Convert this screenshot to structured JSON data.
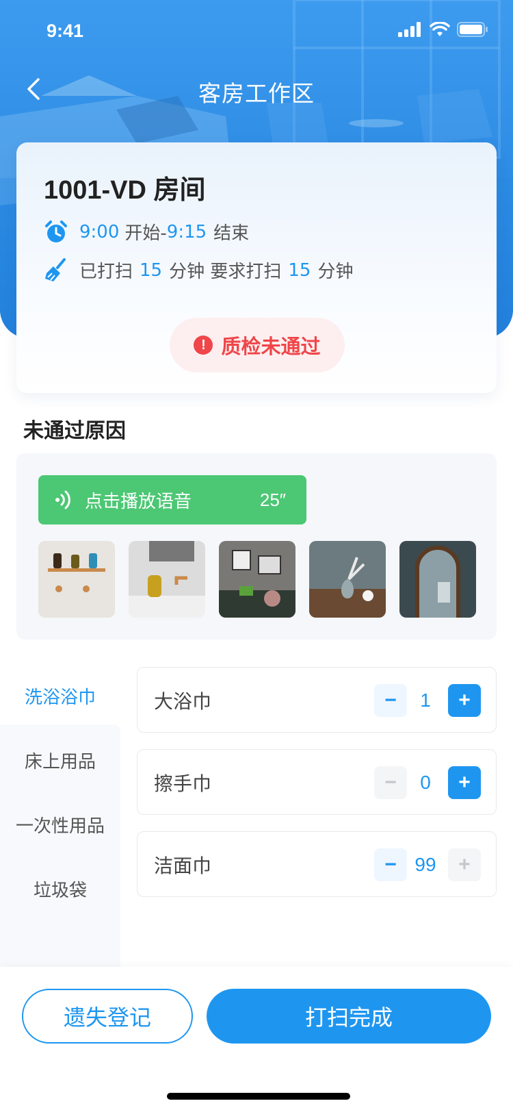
{
  "status_bar": {
    "time": "9:41"
  },
  "nav": {
    "title": "客房工作区"
  },
  "room_card": {
    "room": "1001-VD 房间",
    "time_start": "9:00",
    "time_start_suffix": "开始-",
    "time_end": "9:15",
    "time_end_suffix": "结束",
    "cleaned_prefix": "已打扫",
    "cleaned_minutes": "15",
    "cleaned_mid": "分钟 要求打扫",
    "required_minutes": "15",
    "cleaned_suffix": "分钟",
    "inspection_status": "质检未通过"
  },
  "reason": {
    "title": "未通过原因",
    "voice_label": "点击播放语音",
    "voice_duration": "25″",
    "photos": [
      "bathroom-shelf",
      "sink-soap",
      "sofa-art",
      "table-vase",
      "mirror"
    ]
  },
  "categories": [
    {
      "label": "洗浴浴巾",
      "active": true
    },
    {
      "label": "床上用品",
      "active": false
    },
    {
      "label": "一次性用品",
      "active": false
    },
    {
      "label": "垃圾袋",
      "active": false
    }
  ],
  "items": [
    {
      "name": "大浴巾",
      "qty": "1",
      "minus_enabled": true,
      "plus_enabled": true
    },
    {
      "name": "擦手巾",
      "qty": "0",
      "minus_enabled": false,
      "plus_enabled": true
    },
    {
      "name": "洁面巾",
      "qty": "99",
      "minus_enabled": true,
      "plus_enabled": false
    }
  ],
  "stepper": {
    "minus": "−",
    "plus": "+"
  },
  "actions": {
    "lost": "遗失登记",
    "done": "打扫完成"
  },
  "colors": {
    "accent": "#1e96f0",
    "danger": "#f04549",
    "voice": "#4cc774"
  }
}
